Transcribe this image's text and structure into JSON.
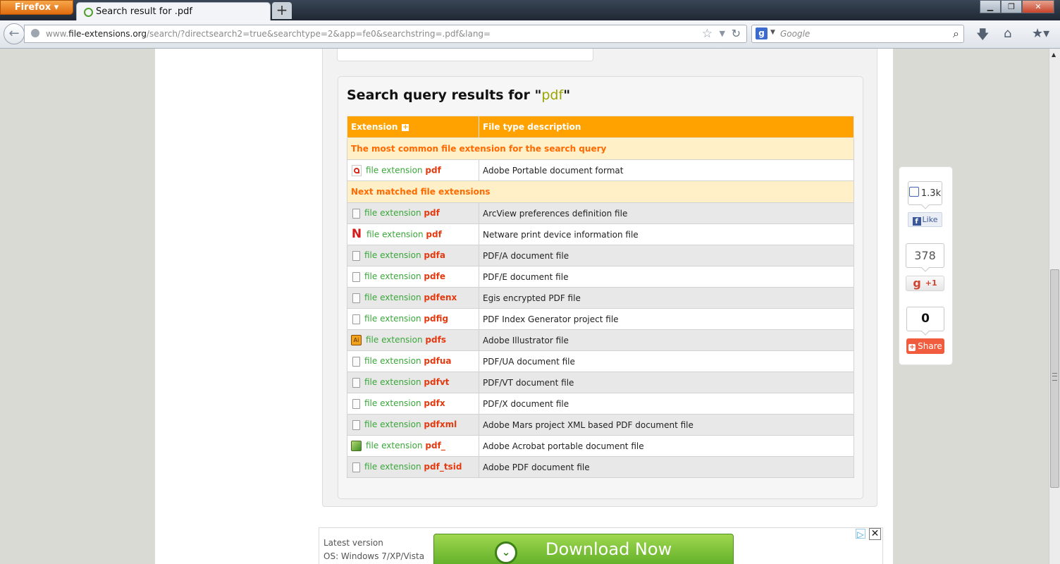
{
  "browser": {
    "menu_label": "Firefox",
    "tab_title": "Search result for .pdf",
    "new_tab_label": "+",
    "url_prefix": "www.",
    "url_domain": "file-extensions.org",
    "url_path": "/search/?directsearch2=true&searchtype=2&app=fe0&searchstring=.pdf&lang=",
    "search_engine_letter": "g",
    "search_placeholder": "Google"
  },
  "results": {
    "title_prefix": "Search query results for \"",
    "query": "pdf",
    "title_suffix": "\"",
    "columns": {
      "extension": "Extension",
      "description": "File type description"
    },
    "link_prefix": "file extension",
    "section_common": "The most common file extension for the search query",
    "section_next": "Next matched file extensions",
    "common": [
      {
        "ext": "pdf",
        "desc": "Adobe Portable document format",
        "icon": "pdf-icon"
      }
    ],
    "matched": [
      {
        "ext": "pdf",
        "desc": "ArcView preferences definition file",
        "icon": "generic-file-icon"
      },
      {
        "ext": "pdf",
        "desc": "Netware print device information file",
        "icon": "netware-icon"
      },
      {
        "ext": "pdfa",
        "desc": "PDF/A document file",
        "icon": "generic-file-icon"
      },
      {
        "ext": "pdfe",
        "desc": "PDF/E document file",
        "icon": "generic-file-icon"
      },
      {
        "ext": "pdfenx",
        "desc": "Egis encrypted PDF file",
        "icon": "generic-file-icon"
      },
      {
        "ext": "pdfig",
        "desc": "PDF Index Generator project file",
        "icon": "generic-file-icon"
      },
      {
        "ext": "pdfs",
        "desc": "Adobe Illustrator file",
        "icon": "illustrator-icon"
      },
      {
        "ext": "pdfua",
        "desc": "PDF/UA document file",
        "icon": "generic-file-icon"
      },
      {
        "ext": "pdfvt",
        "desc": "PDF/VT document file",
        "icon": "generic-file-icon"
      },
      {
        "ext": "pdfx",
        "desc": "PDF/X document file",
        "icon": "generic-file-icon"
      },
      {
        "ext": "pdfxml",
        "desc": "Adobe Mars project XML based PDF document file",
        "icon": "generic-file-icon"
      },
      {
        "ext": "pdf_",
        "desc": "Adobe Acrobat portable document file",
        "icon": "acrobat-icon"
      },
      {
        "ext": "pdf_tsid",
        "desc": "Adobe PDF document file",
        "icon": "generic-file-icon"
      }
    ]
  },
  "social": {
    "fb_count": "1.3k",
    "fb_like": "Like",
    "gplus_count": "378",
    "gplus_label": "+1",
    "share_count": "0",
    "share_label": "Share"
  },
  "ad": {
    "latest": "Latest version",
    "os": "OS: Windows 7/XP/Vista",
    "button": "Download Now"
  },
  "colors": {
    "header_orange": "#ffa200",
    "section_bg": "#fff0c8",
    "ext_red": "#e53a10",
    "link_green": "#3aa63a"
  }
}
